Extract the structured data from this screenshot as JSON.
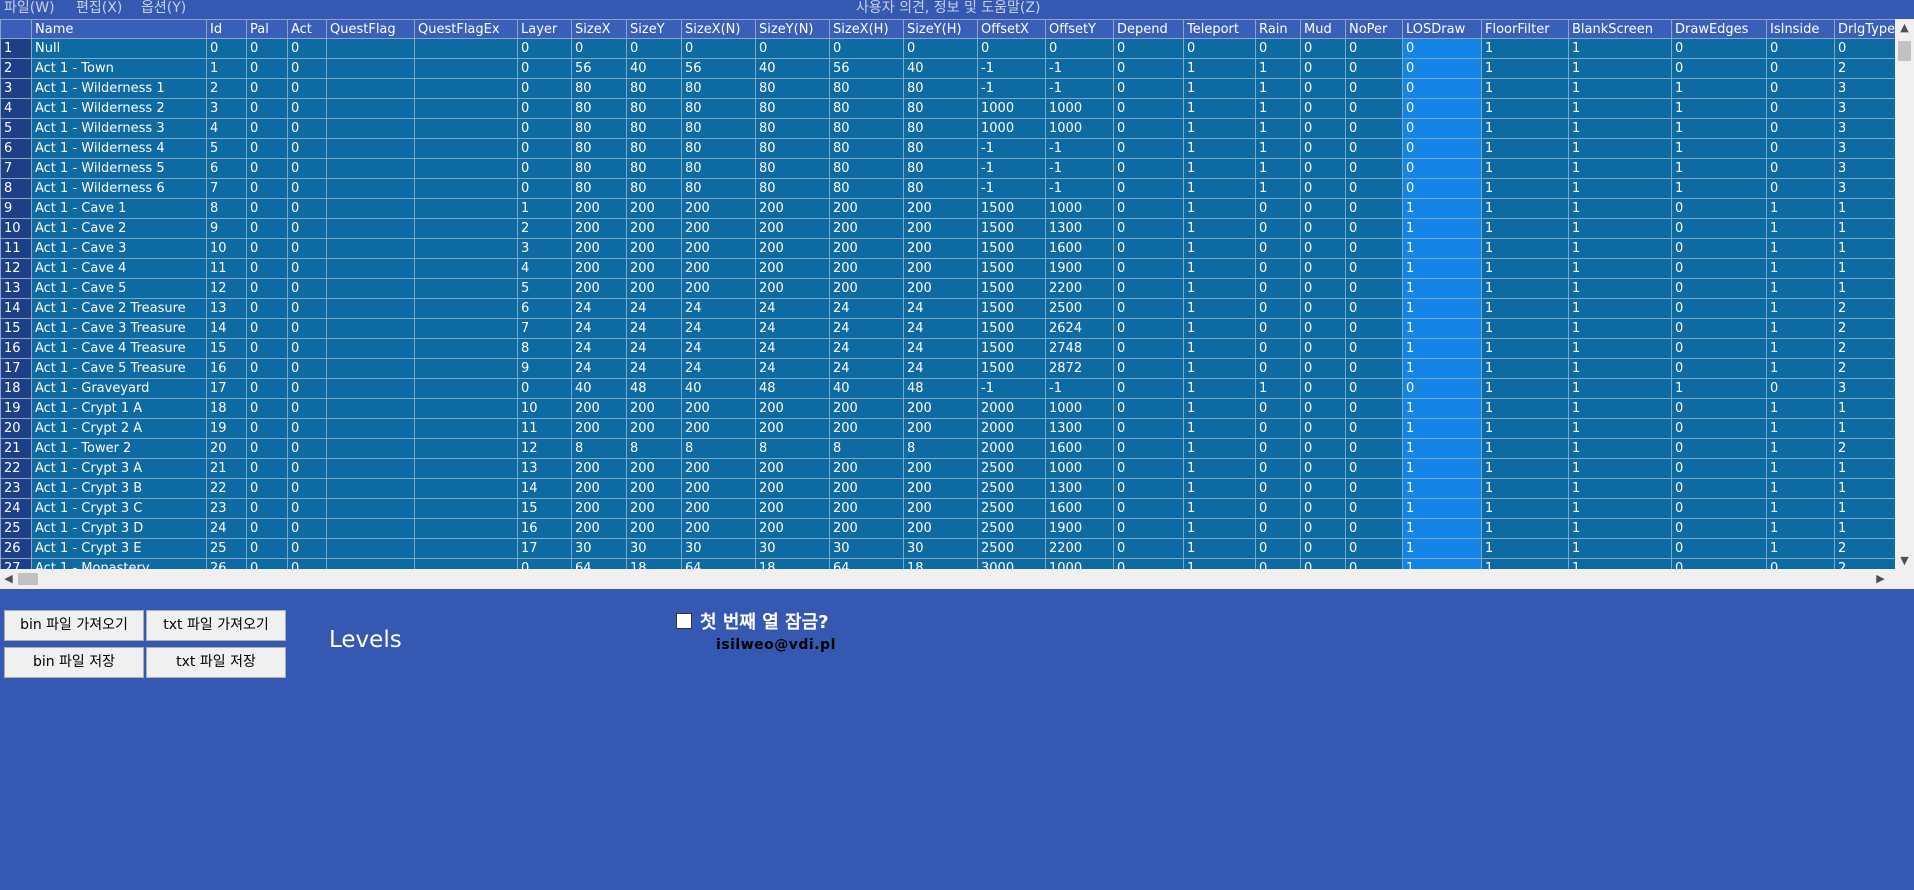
{
  "menu": {
    "items": [
      "파일(W)",
      "편집(X)",
      "옵션(Y)"
    ],
    "center": "사용자 의견, 정보 및 도움말(Z)"
  },
  "columns": [
    {
      "name": "",
      "w": 31
    },
    {
      "name": "Name",
      "w": 175
    },
    {
      "name": "Id",
      "w": 40
    },
    {
      "name": "Pal",
      "w": 41
    },
    {
      "name": "Act",
      "w": 39
    },
    {
      "name": "QuestFlag",
      "w": 88
    },
    {
      "name": "QuestFlagEx",
      "w": 103
    },
    {
      "name": "Layer",
      "w": 54
    },
    {
      "name": "SizeX",
      "w": 55
    },
    {
      "name": "SizeY",
      "w": 55
    },
    {
      "name": "SizeX(N)",
      "w": 74
    },
    {
      "name": "SizeY(N)",
      "w": 74
    },
    {
      "name": "SizeX(H)",
      "w": 74
    },
    {
      "name": "SizeY(H)",
      "w": 74
    },
    {
      "name": "OffsetX",
      "w": 68
    },
    {
      "name": "OffsetY",
      "w": 68
    },
    {
      "name": "Depend",
      "w": 70
    },
    {
      "name": "Teleport",
      "w": 72
    },
    {
      "name": "Rain",
      "w": 45
    },
    {
      "name": "Mud",
      "w": 45
    },
    {
      "name": "NoPer",
      "w": 57
    },
    {
      "name": "LOSDraw",
      "w": 79
    },
    {
      "name": "FloorFilter",
      "w": 87
    },
    {
      "name": "BlankScreen",
      "w": 103
    },
    {
      "name": "DrawEdges",
      "w": 95
    },
    {
      "name": "IsInside",
      "w": 68
    },
    {
      "name": "DrlgType",
      "w": 70
    }
  ],
  "selected_col": 21,
  "rows": [
    [
      "1",
      "Null",
      "0",
      "0",
      "0",
      "",
      "",
      "0",
      "0",
      "0",
      "0",
      "0",
      "0",
      "0",
      "0",
      "0",
      "0",
      "0",
      "0",
      "0",
      "0",
      "0",
      "1",
      "1",
      "0",
      "0",
      "0"
    ],
    [
      "2",
      "Act 1 - Town",
      "1",
      "0",
      "0",
      "",
      "",
      "0",
      "56",
      "40",
      "56",
      "40",
      "56",
      "40",
      "-1",
      "-1",
      "0",
      "1",
      "1",
      "0",
      "0",
      "0",
      "1",
      "1",
      "0",
      "0",
      "2"
    ],
    [
      "3",
      "Act 1 - Wilderness 1",
      "2",
      "0",
      "0",
      "",
      "",
      "0",
      "80",
      "80",
      "80",
      "80",
      "80",
      "80",
      "-1",
      "-1",
      "0",
      "1",
      "1",
      "0",
      "0",
      "0",
      "1",
      "1",
      "1",
      "0",
      "3"
    ],
    [
      "4",
      "Act 1 - Wilderness 2",
      "3",
      "0",
      "0",
      "",
      "",
      "0",
      "80",
      "80",
      "80",
      "80",
      "80",
      "80",
      "1000",
      "1000",
      "0",
      "1",
      "1",
      "0",
      "0",
      "0",
      "1",
      "1",
      "1",
      "0",
      "3"
    ],
    [
      "5",
      "Act 1 - Wilderness 3",
      "4",
      "0",
      "0",
      "",
      "",
      "0",
      "80",
      "80",
      "80",
      "80",
      "80",
      "80",
      "1000",
      "1000",
      "0",
      "1",
      "1",
      "0",
      "0",
      "0",
      "1",
      "1",
      "1",
      "0",
      "3"
    ],
    [
      "6",
      "Act 1 - Wilderness 4",
      "5",
      "0",
      "0",
      "",
      "",
      "0",
      "80",
      "80",
      "80",
      "80",
      "80",
      "80",
      "-1",
      "-1",
      "0",
      "1",
      "1",
      "0",
      "0",
      "0",
      "1",
      "1",
      "1",
      "0",
      "3"
    ],
    [
      "7",
      "Act 1 - Wilderness 5",
      "6",
      "0",
      "0",
      "",
      "",
      "0",
      "80",
      "80",
      "80",
      "80",
      "80",
      "80",
      "-1",
      "-1",
      "0",
      "1",
      "1",
      "0",
      "0",
      "0",
      "1",
      "1",
      "1",
      "0",
      "3"
    ],
    [
      "8",
      "Act 1 - Wilderness 6",
      "7",
      "0",
      "0",
      "",
      "",
      "0",
      "80",
      "80",
      "80",
      "80",
      "80",
      "80",
      "-1",
      "-1",
      "0",
      "1",
      "1",
      "0",
      "0",
      "0",
      "1",
      "1",
      "1",
      "0",
      "3"
    ],
    [
      "9",
      "Act 1 - Cave 1",
      "8",
      "0",
      "0",
      "",
      "",
      "1",
      "200",
      "200",
      "200",
      "200",
      "200",
      "200",
      "1500",
      "1000",
      "0",
      "1",
      "0",
      "0",
      "0",
      "1",
      "1",
      "1",
      "0",
      "1",
      "1"
    ],
    [
      "10",
      "Act 1 - Cave 2",
      "9",
      "0",
      "0",
      "",
      "",
      "2",
      "200",
      "200",
      "200",
      "200",
      "200",
      "200",
      "1500",
      "1300",
      "0",
      "1",
      "0",
      "0",
      "0",
      "1",
      "1",
      "1",
      "0",
      "1",
      "1"
    ],
    [
      "11",
      "Act 1 - Cave 3",
      "10",
      "0",
      "0",
      "",
      "",
      "3",
      "200",
      "200",
      "200",
      "200",
      "200",
      "200",
      "1500",
      "1600",
      "0",
      "1",
      "0",
      "0",
      "0",
      "1",
      "1",
      "1",
      "0",
      "1",
      "1"
    ],
    [
      "12",
      "Act 1 - Cave 4",
      "11",
      "0",
      "0",
      "",
      "",
      "4",
      "200",
      "200",
      "200",
      "200",
      "200",
      "200",
      "1500",
      "1900",
      "0",
      "1",
      "0",
      "0",
      "0",
      "1",
      "1",
      "1",
      "0",
      "1",
      "1"
    ],
    [
      "13",
      "Act 1 - Cave 5",
      "12",
      "0",
      "0",
      "",
      "",
      "5",
      "200",
      "200",
      "200",
      "200",
      "200",
      "200",
      "1500",
      "2200",
      "0",
      "1",
      "0",
      "0",
      "0",
      "1",
      "1",
      "1",
      "0",
      "1",
      "1"
    ],
    [
      "14",
      "Act 1 - Cave 2 Treasure",
      "13",
      "0",
      "0",
      "",
      "",
      "6",
      "24",
      "24",
      "24",
      "24",
      "24",
      "24",
      "1500",
      "2500",
      "0",
      "1",
      "0",
      "0",
      "0",
      "1",
      "1",
      "1",
      "0",
      "1",
      "2"
    ],
    [
      "15",
      "Act 1 - Cave 3 Treasure",
      "14",
      "0",
      "0",
      "",
      "",
      "7",
      "24",
      "24",
      "24",
      "24",
      "24",
      "24",
      "1500",
      "2624",
      "0",
      "1",
      "0",
      "0",
      "0",
      "1",
      "1",
      "1",
      "0",
      "1",
      "2"
    ],
    [
      "16",
      "Act 1 - Cave 4 Treasure",
      "15",
      "0",
      "0",
      "",
      "",
      "8",
      "24",
      "24",
      "24",
      "24",
      "24",
      "24",
      "1500",
      "2748",
      "0",
      "1",
      "0",
      "0",
      "0",
      "1",
      "1",
      "1",
      "0",
      "1",
      "2"
    ],
    [
      "17",
      "Act 1 - Cave 5 Treasure",
      "16",
      "0",
      "0",
      "",
      "",
      "9",
      "24",
      "24",
      "24",
      "24",
      "24",
      "24",
      "1500",
      "2872",
      "0",
      "1",
      "0",
      "0",
      "0",
      "1",
      "1",
      "1",
      "0",
      "1",
      "2"
    ],
    [
      "18",
      "Act 1 - Graveyard",
      "17",
      "0",
      "0",
      "",
      "",
      "0",
      "40",
      "48",
      "40",
      "48",
      "40",
      "48",
      "-1",
      "-1",
      "0",
      "1",
      "1",
      "0",
      "0",
      "0",
      "1",
      "1",
      "1",
      "0",
      "3"
    ],
    [
      "19",
      "Act 1 - Crypt 1 A",
      "18",
      "0",
      "0",
      "",
      "",
      "10",
      "200",
      "200",
      "200",
      "200",
      "200",
      "200",
      "2000",
      "1000",
      "0",
      "1",
      "0",
      "0",
      "0",
      "1",
      "1",
      "1",
      "0",
      "1",
      "1"
    ],
    [
      "20",
      "Act 1 - Crypt 2 A",
      "19",
      "0",
      "0",
      "",
      "",
      "11",
      "200",
      "200",
      "200",
      "200",
      "200",
      "200",
      "2000",
      "1300",
      "0",
      "1",
      "0",
      "0",
      "0",
      "1",
      "1",
      "1",
      "0",
      "1",
      "1"
    ],
    [
      "21",
      "Act 1 - Tower 2",
      "20",
      "0",
      "0",
      "",
      "",
      "12",
      "8",
      "8",
      "8",
      "8",
      "8",
      "8",
      "2000",
      "1600",
      "0",
      "1",
      "0",
      "0",
      "0",
      "1",
      "1",
      "1",
      "0",
      "1",
      "2"
    ],
    [
      "22",
      "Act 1 - Crypt 3 A",
      "21",
      "0",
      "0",
      "",
      "",
      "13",
      "200",
      "200",
      "200",
      "200",
      "200",
      "200",
      "2500",
      "1000",
      "0",
      "1",
      "0",
      "0",
      "0",
      "1",
      "1",
      "1",
      "0",
      "1",
      "1"
    ],
    [
      "23",
      "Act 1 - Crypt 3 B",
      "22",
      "0",
      "0",
      "",
      "",
      "14",
      "200",
      "200",
      "200",
      "200",
      "200",
      "200",
      "2500",
      "1300",
      "0",
      "1",
      "0",
      "0",
      "0",
      "1",
      "1",
      "1",
      "0",
      "1",
      "1"
    ],
    [
      "24",
      "Act 1 - Crypt 3 C",
      "23",
      "0",
      "0",
      "",
      "",
      "15",
      "200",
      "200",
      "200",
      "200",
      "200",
      "200",
      "2500",
      "1600",
      "0",
      "1",
      "0",
      "0",
      "0",
      "1",
      "1",
      "1",
      "0",
      "1",
      "1"
    ],
    [
      "25",
      "Act 1 - Crypt 3 D",
      "24",
      "0",
      "0",
      "",
      "",
      "16",
      "200",
      "200",
      "200",
      "200",
      "200",
      "200",
      "2500",
      "1900",
      "0",
      "1",
      "0",
      "0",
      "0",
      "1",
      "1",
      "1",
      "0",
      "1",
      "1"
    ],
    [
      "26",
      "Act 1 - Crypt 3 E",
      "25",
      "0",
      "0",
      "",
      "",
      "17",
      "30",
      "30",
      "30",
      "30",
      "30",
      "30",
      "2500",
      "2200",
      "0",
      "1",
      "0",
      "0",
      "0",
      "1",
      "1",
      "1",
      "0",
      "1",
      "2"
    ],
    [
      "27",
      "Act 1 - Monastery",
      "26",
      "0",
      "0",
      "",
      "",
      "0",
      "64",
      "18",
      "64",
      "18",
      "64",
      "18",
      "3000",
      "1000",
      "0",
      "1",
      "0",
      "0",
      "0",
      "1",
      "1",
      "1",
      "0",
      "0",
      "2"
    ]
  ],
  "buttons": {
    "load_bin": "bin 파일 가져오기",
    "load_txt": "txt 파일 가져오기",
    "save_bin": "bin 파일 저장",
    "save_txt": "txt 파일 저장"
  },
  "title": "Levels",
  "lock_first_col_label": "첫 번째 열 잠금?",
  "email": "isilweo@vdi.pl"
}
